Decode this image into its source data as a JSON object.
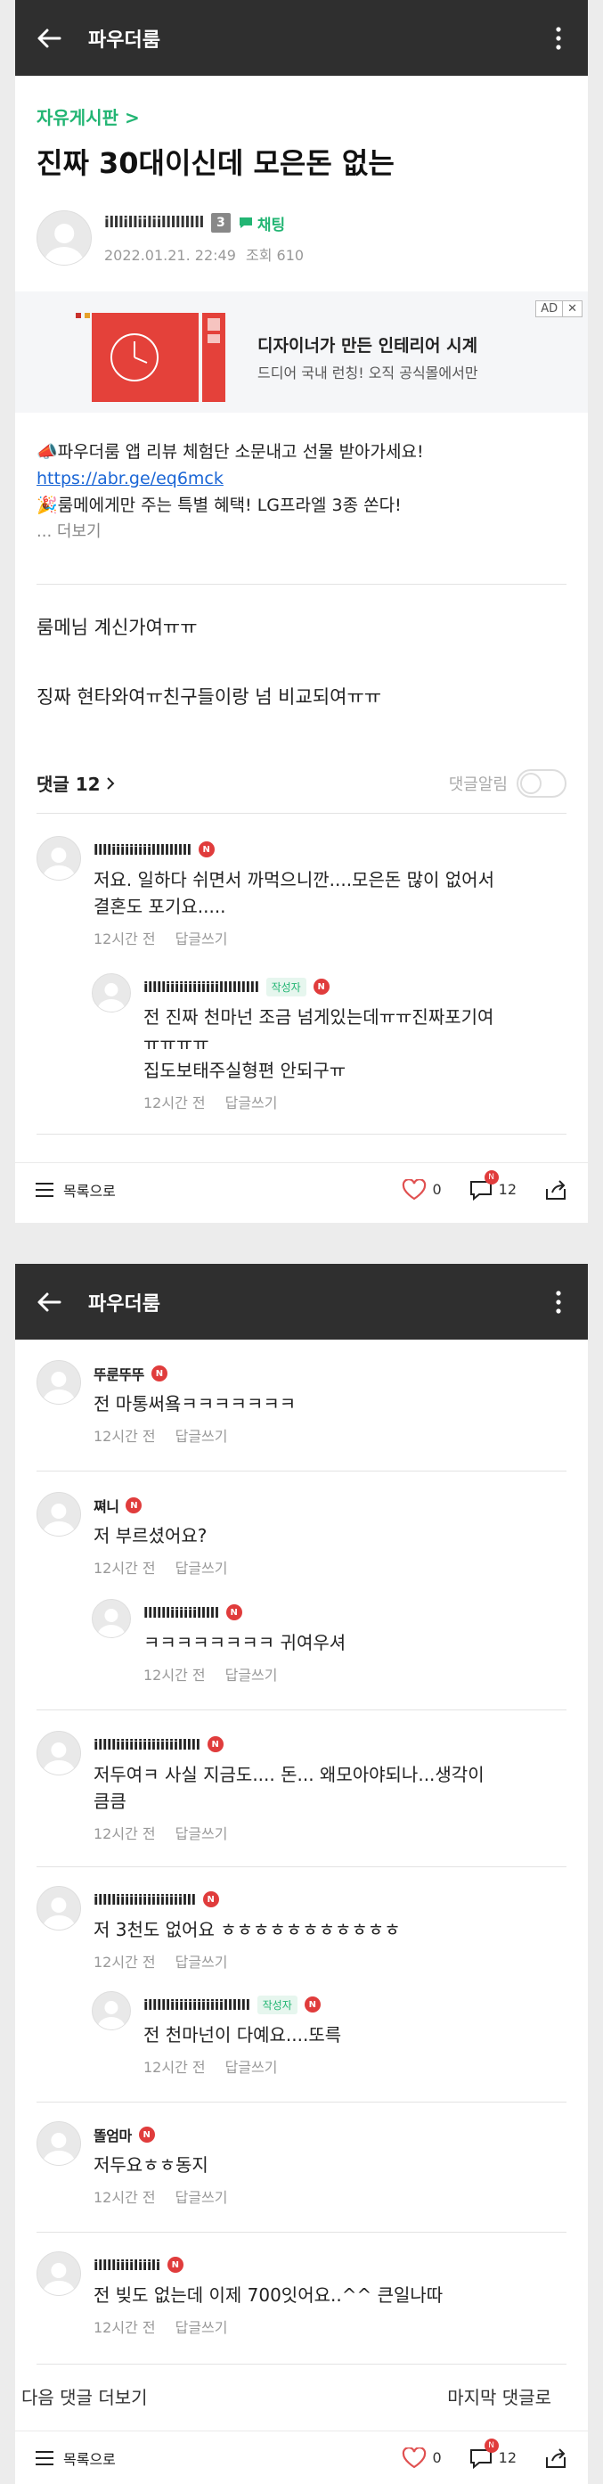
{
  "app": {
    "title": "파우더룸"
  },
  "post": {
    "board": "자유게시판 >",
    "title": "진짜 30대이신데 모은돈 없는",
    "author": "illlilliiliilllllllll",
    "level": "3",
    "chat_label": "채팅",
    "date": "2022.01.21. 22:49",
    "views_label": "조회 610"
  },
  "ad": {
    "badge": "AD",
    "close": "✕",
    "headline": "디자이너가 만든 인테리어 시계",
    "subline": "드디어 국내 런칭! 오직 공식몰에서만"
  },
  "promo": {
    "line1": "📣파우더룸 앱 리뷰 체험단 소문내고 선물 받아가세요!",
    "link": "https://abr.ge/eq6mck",
    "line3": "🎉룸메에게만 주는 특별 혜택! LG프라엘 3종 쏜다!",
    "more": "... 더보기"
  },
  "body": {
    "line1": "룸메님 계신가여ㅠㅠ",
    "line2": "징짜 현타와여ㅠ친구들이랑 넘 비교되여ㅠㅠ"
  },
  "comments_section": {
    "header": "댓글 12",
    "alert_label": "댓글알림"
  },
  "labels": {
    "reply": "답글쓰기",
    "writer": "작성자",
    "n": "N"
  },
  "comments": [
    {
      "name": "lllliiiiiiiiilllllllll",
      "text": "저요. 일하다 쉬면서 까먹으니깐....모은돈 많이 없어서\n결혼도 포기요.....",
      "time": "12시간 전"
    },
    {
      "name": "illlliiiiiiiiiiiilllllllll",
      "text": "전 진짜 천마넌 조금 넘게있는데ㅠㅠ진짜포기여\nㅠㅠㅠㅠ\n집도보태주실형편 안되구ㅠ",
      "time": "12시간 전"
    },
    {
      "name": "뚜룬뚜뚜",
      "text": "전 마통써욬ㅋㅋㅋㅋㅋㅋㅋ",
      "time": "12시간 전"
    },
    {
      "name": "쪄니",
      "text": "저 부르셨어요?",
      "time": "12시간 전"
    },
    {
      "name": "lllllliiiiiilllll",
      "text": "ㅋㅋㅋㅋㅋㅋㅋㅋ 귀여우셔",
      "time": "12시간 전"
    },
    {
      "name": "illlliiiiiiiiiiiiiilllll",
      "text": "저두여ㅋ 사실 지금도.... 돈... 왜모아야되나...생각이\n큼큼",
      "time": "12시간 전"
    },
    {
      "name": "illlliiiiiiiiiiiiiiilll",
      "text": "저 3천도 없어요 ㅎㅎㅎㅎㅎㅎㅎㅎㅎㅎㅎ",
      "time": "12시간 전"
    },
    {
      "name": "illllliiiiiiiiiiiillllll",
      "text": "전 천마넌이 다예요....또륵",
      "time": "12시간 전"
    },
    {
      "name": "똘엄마",
      "text": "저두요ㅎㅎ동지",
      "time": "12시간 전"
    },
    {
      "name": "illlliiiiliiili",
      "text": "전 빚도 없는데 이제 700잇어요..^^ 큰일나따",
      "time": "12시간 전"
    }
  ],
  "bottom": {
    "list_label": "목록으로",
    "likes": "0",
    "comments": "12"
  },
  "more_row": {
    "next": "다음 댓글 더보기",
    "last": "마지막 댓글로"
  },
  "colors": {
    "accent": "#22b573",
    "topbar": "#2f2f2f",
    "badge_red": "#e03c3c",
    "like_red": "#e05050",
    "link": "#1a66d6"
  }
}
